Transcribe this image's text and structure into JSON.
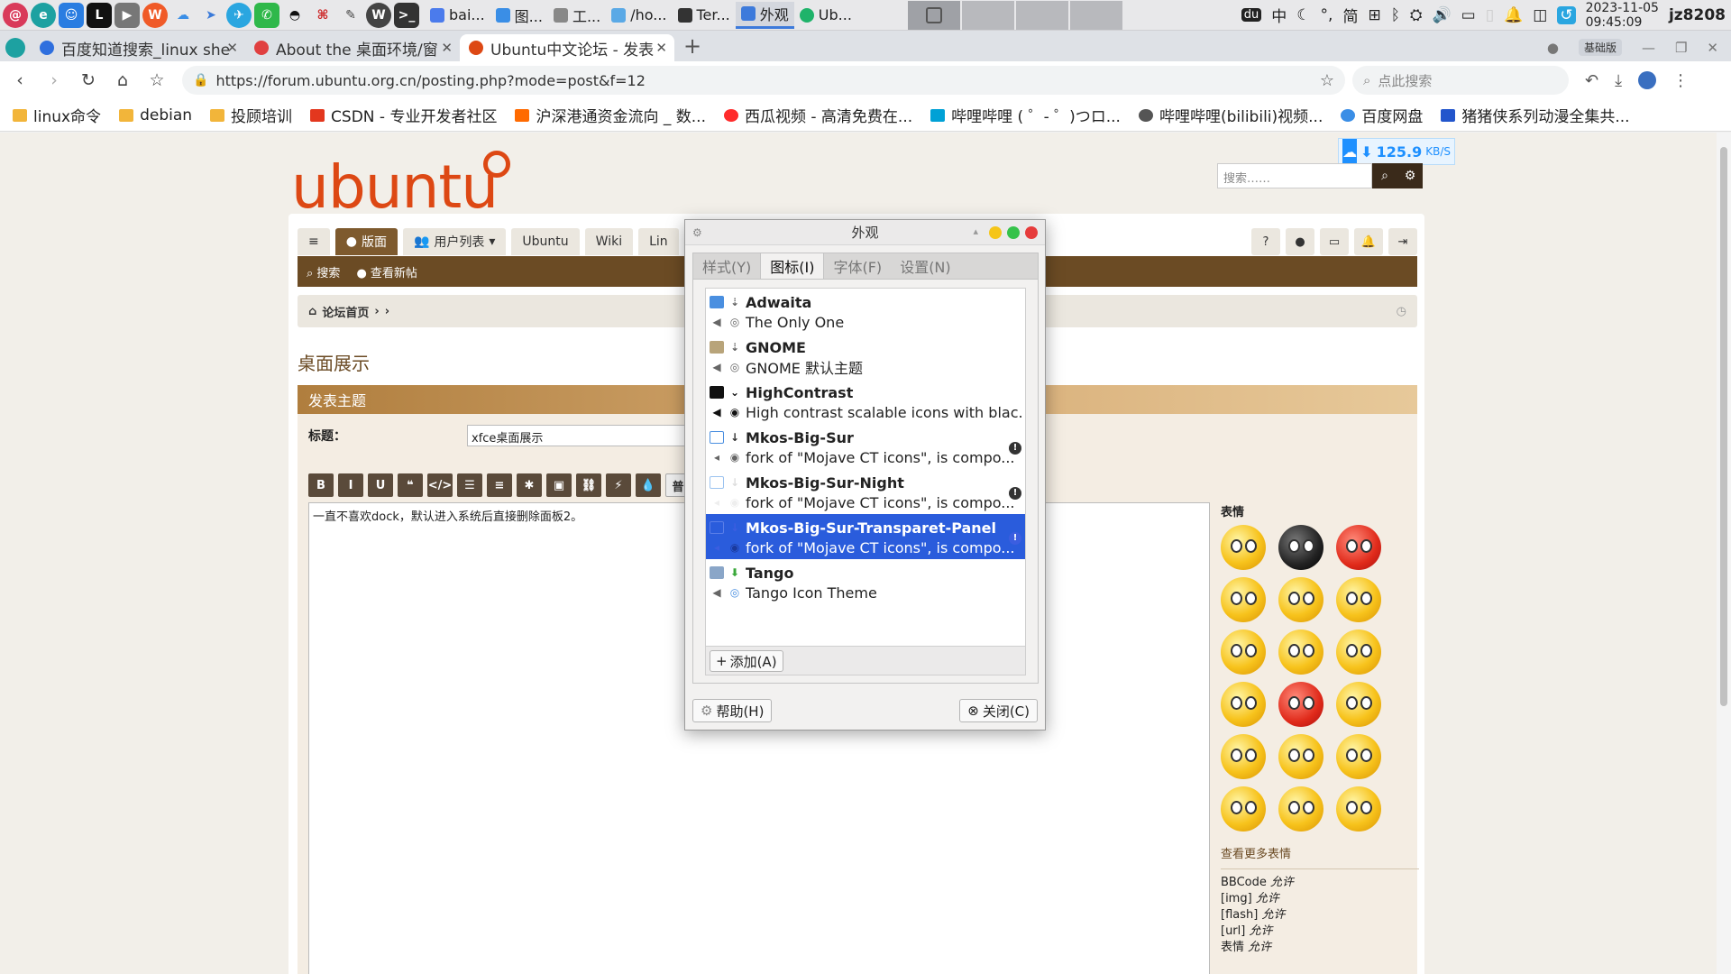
{
  "panel": {
    "tasks": [
      {
        "label": "bai...",
        "color": "#4b7bec"
      },
      {
        "label": "图...",
        "color": "#3a8ee6"
      },
      {
        "label": "工...",
        "color": "#888888"
      },
      {
        "label": "/ho...",
        "color": "#5aa9e6"
      },
      {
        "label": "Ter...",
        "color": "#333333"
      },
      {
        "label": "外观",
        "color": "#3d7adb"
      },
      {
        "label": "Ub...",
        "color": "#1fb36a"
      }
    ],
    "tray": {
      "ime": "中",
      "moon": "☾",
      "punct": "°,",
      "script": "简",
      "grid": "⊞",
      "bluetooth": "ᛒ",
      "net": "⛭",
      "volume": "🔊",
      "battery": "▭",
      "bell": "🔔"
    },
    "date": "2023-11-05",
    "time": "09:45:09",
    "user": "jz8208"
  },
  "browser": {
    "tabs": [
      {
        "title": "百度知道搜索_linux she",
        "color": "#2f6fde"
      },
      {
        "title": "About the 桌面环境/窗",
        "color": "#e04040"
      },
      {
        "title": "Ubuntu中文论坛 - 发表",
        "color": "#dd4814"
      }
    ],
    "badge": "基础版",
    "url": "https://forum.ubuntu.org.cn/posting.php?mode=post&f=12",
    "search_placeholder": "点此搜索",
    "bookmarks": [
      {
        "label": "linux命令",
        "color": "#f2b53a"
      },
      {
        "label": "debian",
        "color": "#f2b53a"
      },
      {
        "label": "投顾培训",
        "color": "#f2b53a"
      },
      {
        "label": "CSDN - 专业开发者社区",
        "color": "#e3371e"
      },
      {
        "label": "沪深港通资金流向 _ 数...",
        "color": "#ff6a00"
      },
      {
        "label": "西瓜视频 - 高清免费在...",
        "color": "#ff2b2b"
      },
      {
        "label": "哔哩哔哩 ( ゜- ゜)つロ...",
        "color": "#00a1d6"
      },
      {
        "label": "哔哩哔哩(bilibili)视频...",
        "color": "#555555"
      },
      {
        "label": "百度网盘",
        "color": "#3a8ee6"
      },
      {
        "label": "猪猪侠系列动漫全集共...",
        "color": "#2255cc"
      }
    ]
  },
  "forum": {
    "logo": "ubuntu",
    "search_placeholder": "搜索……",
    "speed": "125.9",
    "speed_unit": "KB/S",
    "nav": {
      "menu": "≡",
      "board": "版面",
      "users": "用户列表",
      "ubuntu": "Ubuntu",
      "wiki": "Wiki",
      "lin": "Lin",
      "search": "搜索",
      "new_posts": "查看新帖"
    },
    "breadcrumb": "论坛首页",
    "title": "桌面展示",
    "post_header": "发表主题",
    "subject_label": "标题：",
    "subject_value": "xfce桌面展示",
    "message": "一直不喜欢dock，默认进入系统后直接删除面板2。",
    "format_buttons": [
      "B",
      "I",
      "U",
      "❝",
      "</>",
      "☰",
      "≡",
      "✱",
      "▣",
      "⛓",
      "⚡",
      "💧",
      "普"
    ],
    "emoji_label": "表情",
    "more_emoji": "查看更多表情",
    "permissions": [
      {
        "name": "BBCode",
        "state": "允许"
      },
      {
        "name": "[img]",
        "state": "允许"
      },
      {
        "name": "[flash]",
        "state": "允许"
      },
      {
        "name": "[url]",
        "state": "允许"
      },
      {
        "name": "表情",
        "state": "允许"
      }
    ]
  },
  "dialog": {
    "title": "外观",
    "tabs": [
      "样式(Y)",
      "图标(I)",
      "字体(F)",
      "设置(N)"
    ],
    "active_tab": 1,
    "themes": [
      {
        "name": "Adwaita",
        "desc": "The Only One"
      },
      {
        "name": "GNOME",
        "desc": "GNOME 默认主题"
      },
      {
        "name": "HighContrast",
        "desc": "High contrast scalable icons with blac..."
      },
      {
        "name": "Mkos-Big-Sur",
        "desc": "fork of \"Mojave CT icons\", is compo..."
      },
      {
        "name": "Mkos-Big-Sur-Night",
        "desc": "fork of \"Mojave CT icons\", is compo..."
      },
      {
        "name": "Mkos-Big-Sur-Transparet-Panel",
        "desc": "fork of \"Mojave CT icons\", is compo..."
      },
      {
        "name": "Tango",
        "desc": "Tango Icon Theme"
      }
    ],
    "selected_index": 5,
    "add_label": "添加(A)",
    "help_label": "帮助(H)",
    "close_label": "关闭(C)"
  }
}
